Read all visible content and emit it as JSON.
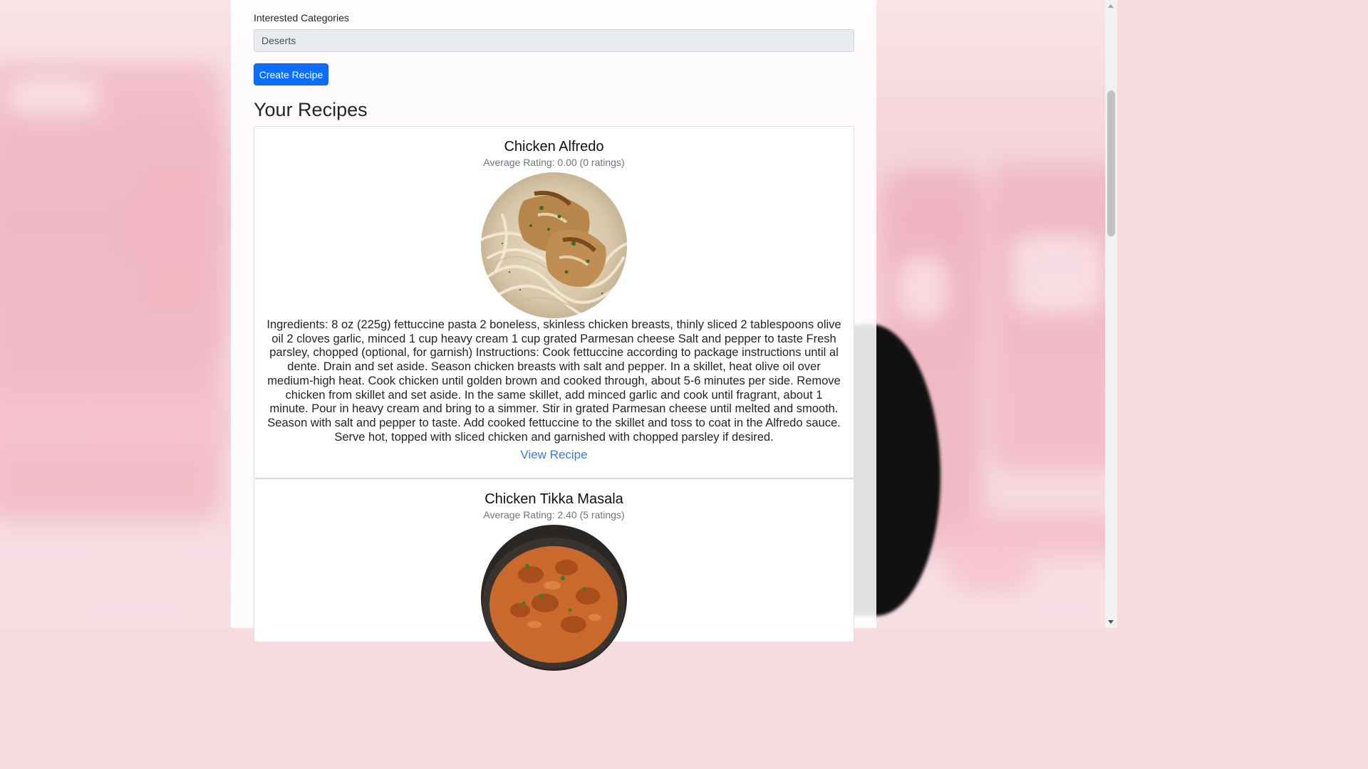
{
  "form": {
    "categories_label": "Interested Categories",
    "categories_value": "Deserts",
    "create_button": "Create Recipe"
  },
  "section_title": "Your Recipes",
  "recipes": [
    {
      "title": "Chicken Alfredo",
      "rating": "Average Rating: 0.00 (0 ratings)",
      "description": "Ingredients: 8 oz (225g) fettuccine pasta 2 boneless, skinless chicken breasts, thinly sliced 2 tablespoons olive oil 2 cloves garlic, minced 1 cup heavy cream 1 cup grated Parmesan cheese Salt and pepper to taste Fresh parsley, chopped (optional, for garnish) Instructions: Cook fettuccine according to package instructions until al dente. Drain and set aside. Season chicken breasts with salt and pepper. In a skillet, heat olive oil over medium-high heat. Cook chicken until golden brown and cooked through, about 5-6 minutes per side. Remove chicken from skillet and set aside. In the same skillet, add minced garlic and cook until fragrant, about 1 minute. Pour in heavy cream and bring to a simmer. Stir in grated Parmesan cheese until melted and smooth. Season with salt and pepper to taste. Add cooked fettuccine to the skillet and toss to coat in the Alfredo sauce. Serve hot, topped with sliced chicken and garnished with chopped parsley if desired.",
      "link": "View Recipe"
    },
    {
      "title": "Chicken Tikka Masala",
      "rating": "Average Rating: 2.40 (5 ratings)"
    }
  ],
  "colors": {
    "primary_button": "#0d6efd",
    "link": "#3b7ddd"
  }
}
